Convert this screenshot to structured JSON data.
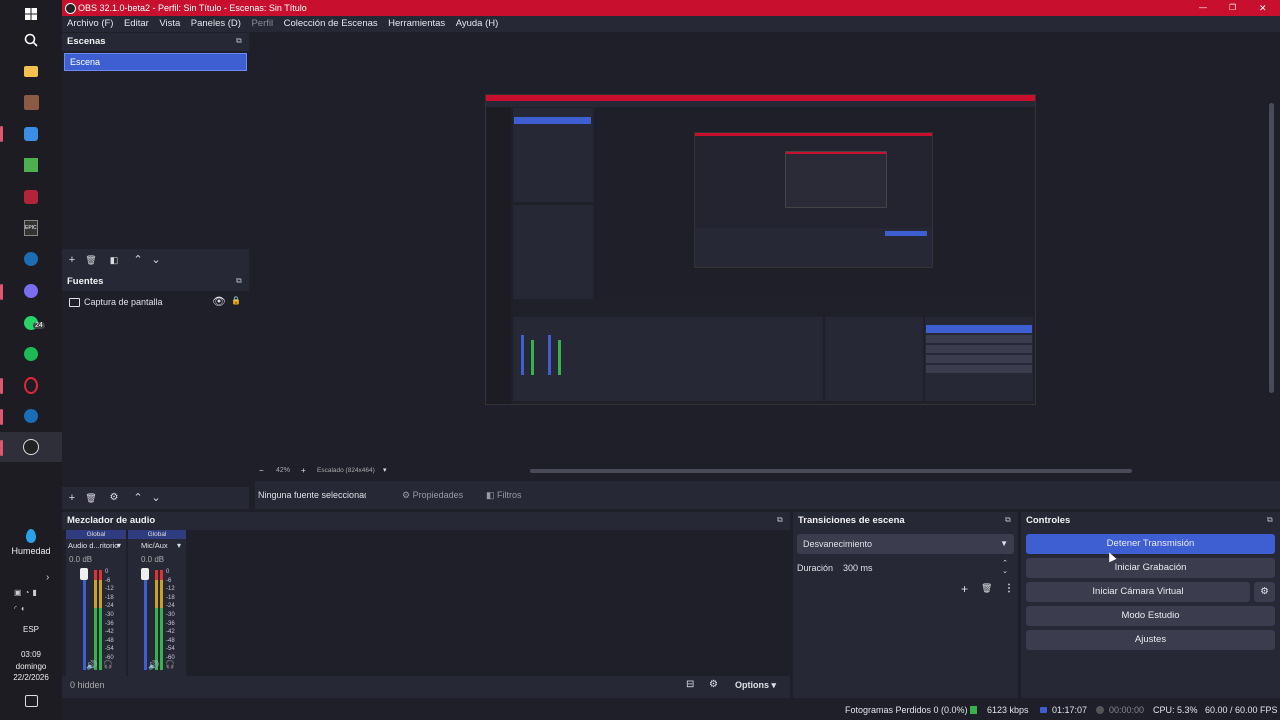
{
  "window": {
    "title": "OBS 32.1.0-beta2 - Perfil: Sin Título - Escenas: Sin Título",
    "controls": [
      "—",
      "❐",
      "✕"
    ]
  },
  "menu": [
    "Archivo (F)",
    "Editar",
    "Vista",
    "Paneles (D)",
    "Perfil",
    "Colección de Escenas",
    "Herramientas",
    "Ayuda (H)"
  ],
  "taskbar": {
    "weather_label": "Humedad",
    "lang": "ESP",
    "time": "03:09",
    "day": "domingo",
    "date": "22/2/2026",
    "notification_badge": "24"
  },
  "scenes": {
    "title": "Escenas",
    "items": [
      "Escena"
    ]
  },
  "sources": {
    "title": "Fuentes",
    "items": [
      "Captura de pantalla"
    ]
  },
  "preview": {
    "zoom": "42%",
    "scale_label": "Escalado (824x464)"
  },
  "context_bar": {
    "no_source": "Ninguna fuente seleccionada",
    "properties": "Propiedades",
    "filters": "Filtros"
  },
  "mixer": {
    "title": "Mezclador de audio",
    "channels": [
      {
        "tag": "Global",
        "name": "Audio d...ritorio",
        "db": "0.0 dB"
      },
      {
        "tag": "Global",
        "name": "Mic/Aux",
        "db": "0.0 dB"
      }
    ],
    "scale": [
      "0",
      "-6",
      "-12",
      "-18",
      "-24",
      "-30",
      "-36",
      "-42",
      "-48",
      "-54",
      "-60"
    ],
    "hidden": "0 hidden",
    "options": "Options"
  },
  "transitions": {
    "title": "Transiciones de escena",
    "selected": "Desvanecimiento",
    "duration_label": "Duración",
    "duration_value": "300 ms"
  },
  "controls": {
    "title": "Controles",
    "stop_stream": "Detener Transmisión",
    "start_record": "Iniciar Grabación",
    "virtual_cam": "Iniciar Cámara Virtual",
    "studio_mode": "Modo Estudio",
    "settings": "Ajustes"
  },
  "statusbar": {
    "dropped": "Fotogramas Perdidos 0 (0.0%)",
    "bitrate": "6123 kbps",
    "stream_time": "01:17:07",
    "rec_time": "00:00:00",
    "cpu": "CPU: 5.3%",
    "fps": "60.00 / 60.00 FPS"
  },
  "colors": {
    "accent": "#3d5fd1",
    "title_bar": "#c8102e",
    "panel": "#272836",
    "background": "#1e1f29"
  }
}
